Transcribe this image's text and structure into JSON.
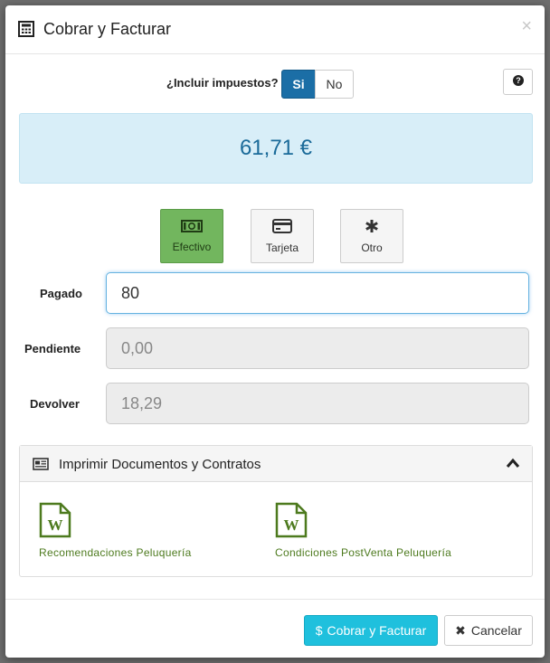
{
  "modal": {
    "title": "Cobrar y Facturar",
    "close_icon": "close-icon",
    "header_icon": "calculator-icon"
  },
  "tax": {
    "label": "¿Incluir impuestos?",
    "yes_label": "Si",
    "no_label": "No",
    "selected": "Si",
    "help_icon": "question-circle-icon"
  },
  "amount": {
    "total": "61,71 €"
  },
  "payment_methods": [
    {
      "label": "Efectivo",
      "icon": "money-icon",
      "active": true
    },
    {
      "label": "Tarjeta",
      "icon": "credit-card-icon",
      "active": false
    },
    {
      "label": "Otro",
      "icon": "asterisk-icon",
      "active": false
    }
  ],
  "fields": {
    "pagado": {
      "label": "Pagado",
      "value": "80"
    },
    "pendiente": {
      "label": "Pendiente",
      "value": "0,00"
    },
    "devolver": {
      "label": "Devolver",
      "value": "18,29"
    }
  },
  "documents": {
    "title": "Imprimir Documentos y Contratos",
    "items": [
      {
        "label": "Recomendaciones Peluquería",
        "icon": "word-document-icon"
      },
      {
        "label": "Condiciones PostVenta Peluquería",
        "icon": "word-document-icon"
      }
    ]
  },
  "footer": {
    "submit_label": "Cobrar y Facturar",
    "submit_icon_glyph": "$",
    "cancel_label": "Cancelar",
    "cancel_icon_glyph": "✖"
  },
  "colors": {
    "primary": "#1b6ea6",
    "amount_bg": "#d8eef8",
    "amount_text": "#1a6a99",
    "active_payment": "#72b65e",
    "submit": "#1fc0dd",
    "document_green": "#4d7a1e"
  }
}
